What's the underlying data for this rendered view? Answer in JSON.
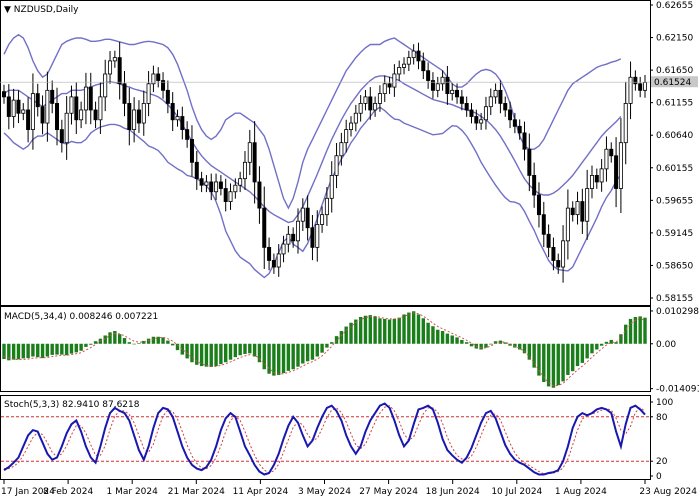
{
  "header": {
    "symbol": "NZDUSD,Daily",
    "macd_label": "MACD(5,34,4) 0.008246 0.007221",
    "stoch_label": "Stoch(5,3,3) 82.9410 87.6218"
  },
  "colors": {
    "candle": "#000000",
    "bands": "#7070c8",
    "macd_hist": "#1a7f1a",
    "macd_signal": "#d05050",
    "stoch_main": "#1818b0",
    "stoch_signal": "#d04040",
    "level_line": "#d03030",
    "price_tag_bg": "#c8c8c8",
    "grid_line": "#000000"
  },
  "chart_data": [
    {
      "type": "candlestick",
      "panel": "price",
      "title": "NZDUSD,Daily",
      "ylim": [
        0.5815,
        0.6275
      ],
      "y_ticks": [
        "0.62655",
        "0.62150",
        "0.61650",
        "0.61155",
        "0.60640",
        "0.60155",
        "0.59655",
        "0.59145",
        "0.58650",
        "0.58155"
      ],
      "last_price": "0.61524",
      "x_ticks": [
        "17 Jan 2024",
        "8 Feb 2024",
        "1 Mar 2024",
        "21 Mar 2024",
        "11 Apr 2024",
        "3 May 2024",
        "27 May 2024",
        "18 Jun 2024",
        "10 Jul 2024",
        "1 Aug 2024",
        "23 Aug 2024"
      ],
      "close": [
        0.613,
        0.61,
        0.6125,
        0.6105,
        0.611,
        0.608,
        0.6135,
        0.6115,
        0.609,
        0.614,
        0.612,
        0.608,
        0.606,
        0.6105,
        0.613,
        0.6095,
        0.611,
        0.6145,
        0.611,
        0.6095,
        0.613,
        0.6165,
        0.6185,
        0.619,
        0.615,
        0.612,
        0.608,
        0.611,
        0.609,
        0.612,
        0.615,
        0.6165,
        0.6155,
        0.614,
        0.612,
        0.6095,
        0.61,
        0.608,
        0.6065,
        0.603,
        0.6005,
        0.5995,
        0.6,
        0.5985,
        0.6,
        0.599,
        0.597,
        0.5985,
        0.5995,
        0.6005,
        0.603,
        0.606,
        0.6,
        0.596,
        0.59,
        0.588,
        0.587,
        0.589,
        0.5905,
        0.592,
        0.591,
        0.594,
        0.596,
        0.593,
        0.59,
        0.5935,
        0.595,
        0.5975,
        0.601,
        0.604,
        0.606,
        0.608,
        0.609,
        0.6105,
        0.612,
        0.613,
        0.611,
        0.612,
        0.6135,
        0.615,
        0.6145,
        0.6165,
        0.6175,
        0.618,
        0.619,
        0.62,
        0.6185,
        0.617,
        0.6155,
        0.614,
        0.615,
        0.616,
        0.6135,
        0.614,
        0.613,
        0.612,
        0.611,
        0.61,
        0.609,
        0.6095,
        0.6115,
        0.613,
        0.614,
        0.612,
        0.611,
        0.6095,
        0.6085,
        0.6075,
        0.605,
        0.601,
        0.598,
        0.595,
        0.592,
        0.59,
        0.588,
        0.587,
        0.591,
        0.596,
        0.595,
        0.597,
        0.594,
        0.599,
        0.601,
        0.6,
        0.602,
        0.605,
        0.604,
        0.599,
        0.606,
        0.612,
        0.616,
        0.615,
        0.614,
        0.6152
      ],
      "bands": {
        "upper": [
          0.6195,
          0.621,
          0.622,
          0.6225,
          0.622,
          0.6205,
          0.6185,
          0.617,
          0.616,
          0.6165,
          0.618,
          0.6195,
          0.621,
          0.6215,
          0.6218,
          0.622,
          0.622,
          0.6218,
          0.6215,
          0.6215,
          0.6216,
          0.6218,
          0.6218,
          0.6216,
          0.6214,
          0.6212,
          0.621,
          0.621,
          0.6212,
          0.6214,
          0.6215,
          0.6214,
          0.6212,
          0.621,
          0.6205,
          0.6195,
          0.618,
          0.616,
          0.614,
          0.6115,
          0.6095,
          0.608,
          0.607,
          0.6065,
          0.607,
          0.608,
          0.6095,
          0.61,
          0.6105,
          0.6105,
          0.61,
          0.6095,
          0.609,
          0.608,
          0.607,
          0.605,
          0.6025,
          0.6,
          0.5975,
          0.596,
          0.5975,
          0.6,
          0.603,
          0.605,
          0.6065,
          0.608,
          0.6095,
          0.611,
          0.6125,
          0.614,
          0.6155,
          0.617,
          0.618,
          0.619,
          0.6198,
          0.6205,
          0.621,
          0.621,
          0.621,
          0.6215,
          0.6218,
          0.622,
          0.6215,
          0.621,
          0.6205,
          0.62,
          0.6195,
          0.619,
          0.6185,
          0.618,
          0.6175,
          0.617,
          0.616,
          0.615,
          0.6145,
          0.6145,
          0.615,
          0.6158,
          0.6165,
          0.617,
          0.6172,
          0.617,
          0.6165,
          0.6155,
          0.614,
          0.612,
          0.6095,
          0.607,
          0.6055,
          0.605,
          0.605,
          0.6055,
          0.6065,
          0.608,
          0.6095,
          0.611,
          0.6125,
          0.614,
          0.615,
          0.6155,
          0.616,
          0.6165,
          0.617,
          0.6175,
          0.6178,
          0.618,
          0.6183,
          0.6185,
          0.6188
        ],
        "middle": [
          0.6135,
          0.614,
          0.614,
          0.614,
          0.6135,
          0.613,
          0.6125,
          0.612,
          0.6115,
          0.612,
          0.6125,
          0.613,
          0.6135,
          0.6135,
          0.614,
          0.614,
          0.614,
          0.6142,
          0.6145,
          0.6148,
          0.615,
          0.6152,
          0.6153,
          0.6152,
          0.615,
          0.6147,
          0.6145,
          0.6142,
          0.614,
          0.6138,
          0.6135,
          0.6133,
          0.613,
          0.6125,
          0.6118,
          0.611,
          0.61,
          0.6088,
          0.6075,
          0.6062,
          0.605,
          0.604,
          0.6032,
          0.6025,
          0.602,
          0.6015,
          0.601,
          0.6005,
          0.6,
          0.5995,
          0.599,
          0.5985,
          0.5978,
          0.597,
          0.5962,
          0.5955,
          0.595,
          0.5946,
          0.5942,
          0.5938,
          0.594,
          0.595,
          0.5962,
          0.5978,
          0.5995,
          0.6012,
          0.603,
          0.6048,
          0.6065,
          0.608,
          0.6095,
          0.6108,
          0.612,
          0.613,
          0.614,
          0.6148,
          0.6155,
          0.616,
          0.6162,
          0.6162,
          0.616,
          0.6158,
          0.6155,
          0.615,
          0.6146,
          0.6142,
          0.6138,
          0.6134,
          0.613,
          0.6126,
          0.6124,
          0.6122,
          0.612,
          0.6118,
          0.6115,
          0.6112,
          0.611,
          0.6108,
          0.6105,
          0.61,
          0.6095,
          0.6088,
          0.608,
          0.607,
          0.6058,
          0.6045,
          0.6032,
          0.6018,
          0.6005,
          0.5995,
          0.5988,
          0.5982,
          0.598,
          0.598,
          0.5983,
          0.5988,
          0.5995,
          0.6002,
          0.601,
          0.602,
          0.603,
          0.604,
          0.605,
          0.606,
          0.607,
          0.6078,
          0.6085,
          0.6092,
          0.61
        ],
        "lower": [
          0.6075,
          0.6068,
          0.606,
          0.6055,
          0.605,
          0.6055,
          0.6065,
          0.607,
          0.607,
          0.6075,
          0.607,
          0.6065,
          0.606,
          0.6058,
          0.6062,
          0.606,
          0.606,
          0.6065,
          0.6075,
          0.608,
          0.6084,
          0.6086,
          0.6088,
          0.6088,
          0.6086,
          0.6082,
          0.608,
          0.6074,
          0.6068,
          0.6062,
          0.6055,
          0.6052,
          0.6048,
          0.604,
          0.603,
          0.6025,
          0.602,
          0.6016,
          0.601,
          0.6008,
          0.6005,
          0.6,
          0.5994,
          0.5985,
          0.597,
          0.595,
          0.5925,
          0.591,
          0.5895,
          0.5885,
          0.588,
          0.5875,
          0.5866,
          0.586,
          0.5854,
          0.586,
          0.5875,
          0.5892,
          0.5909,
          0.5916,
          0.5905,
          0.59,
          0.5894,
          0.5906,
          0.5925,
          0.5944,
          0.5965,
          0.5986,
          0.6005,
          0.602,
          0.6035,
          0.6046,
          0.606,
          0.607,
          0.6082,
          0.6091,
          0.61,
          0.611,
          0.6114,
          0.6109,
          0.6102,
          0.6096,
          0.6095,
          0.609,
          0.6087,
          0.6084,
          0.6081,
          0.6078,
          0.6075,
          0.6072,
          0.6073,
          0.6074,
          0.608,
          0.6086,
          0.6085,
          0.6079,
          0.607,
          0.6058,
          0.6045,
          0.603,
          0.6018,
          0.6006,
          0.5995,
          0.5985,
          0.5976,
          0.597,
          0.5969,
          0.5966,
          0.5955,
          0.594,
          0.5926,
          0.5909,
          0.5895,
          0.588,
          0.5871,
          0.5866,
          0.5865,
          0.5864,
          0.587,
          0.5885,
          0.59,
          0.5915,
          0.593,
          0.5945,
          0.5962,
          0.5976,
          0.5987,
          0.6001,
          0.6012
        ]
      }
    },
    {
      "type": "bar",
      "panel": "macd",
      "title": "MACD(5,34,4) 0.008246 0.007221",
      "ylim": [
        -0.0142,
        0.0106
      ],
      "y_ticks": [
        "0.010298",
        "0.00",
        "-0.014091"
      ],
      "histogram": [
        -0.0048,
        -0.0052,
        -0.005,
        -0.0049,
        -0.0046,
        -0.0045,
        -0.004,
        -0.0042,
        -0.0045,
        -0.004,
        -0.0035,
        -0.0034,
        -0.0034,
        -0.0036,
        -0.0031,
        -0.0027,
        -0.0022,
        -0.001,
        -0.0003,
        0.0008,
        0.0016,
        0.0026,
        0.0036,
        0.004,
        0.003,
        0.0018,
        0.0005,
        0.0,
        0.0002,
        0.0009,
        0.0016,
        0.0022,
        0.0022,
        0.002,
        0.001,
        -0.0005,
        -0.002,
        -0.0034,
        -0.0046,
        -0.0058,
        -0.0066,
        -0.007,
        -0.0072,
        -0.0073,
        -0.007,
        -0.0064,
        -0.0058,
        -0.005,
        -0.0042,
        -0.0036,
        -0.0032,
        -0.003,
        -0.004,
        -0.0058,
        -0.008,
        -0.0094,
        -0.01,
        -0.0098,
        -0.0092,
        -0.0085,
        -0.008,
        -0.0072,
        -0.0062,
        -0.0055,
        -0.005,
        -0.004,
        -0.0028,
        -0.0012,
        0.0005,
        0.0024,
        0.004,
        0.0054,
        0.0066,
        0.0076,
        0.0084,
        0.0088,
        0.009,
        0.0086,
        0.008,
        0.0078,
        0.0076,
        0.0078,
        0.0082,
        0.0092,
        0.0098,
        0.0102,
        0.0092,
        0.008,
        0.0066,
        0.0055,
        0.0044,
        0.004,
        0.0032,
        0.0026,
        0.002,
        0.0012,
        0.0005,
        -0.0008,
        -0.0015,
        -0.0018,
        -0.0012,
        -0.0002,
        0.0008,
        0.001,
        0.0004,
        -0.0006,
        -0.0012,
        -0.0018,
        -0.003,
        -0.005,
        -0.0075,
        -0.01,
        -0.012,
        -0.0134,
        -0.0138,
        -0.013,
        -0.0118,
        -0.0098,
        -0.0086,
        -0.007,
        -0.006,
        -0.0046,
        -0.003,
        -0.0018,
        -0.0006,
        0.0006,
        0.0012,
        0.0005,
        0.003,
        0.006,
        0.0078,
        0.0084,
        0.0086,
        0.0082
      ],
      "signal": [
        -0.004,
        -0.0045,
        -0.0048,
        -0.005,
        -0.0049,
        -0.0048,
        -0.0045,
        -0.0044,
        -0.0044,
        -0.0043,
        -0.004,
        -0.0038,
        -0.0036,
        -0.0036,
        -0.0034,
        -0.0031,
        -0.0028,
        -0.002,
        -0.0012,
        -0.0002,
        0.0008,
        0.0017,
        0.0026,
        0.0032,
        0.0031,
        0.0025,
        0.0016,
        0.0008,
        0.0005,
        0.0006,
        0.001,
        0.0015,
        0.0019,
        0.002,
        0.0016,
        0.0008,
        -0.0004,
        -0.0017,
        -0.003,
        -0.0043,
        -0.0054,
        -0.0063,
        -0.0068,
        -0.0071,
        -0.0071,
        -0.0068,
        -0.0063,
        -0.0057,
        -0.005,
        -0.0043,
        -0.0038,
        -0.0034,
        -0.0036,
        -0.0046,
        -0.0062,
        -0.0078,
        -0.009,
        -0.0095,
        -0.0094,
        -0.009,
        -0.0085,
        -0.0078,
        -0.007,
        -0.0062,
        -0.0056,
        -0.0048,
        -0.0038,
        -0.0024,
        -0.0008,
        0.001,
        0.0026,
        0.0042,
        0.0055,
        0.0066,
        0.0076,
        0.0082,
        0.0086,
        0.0086,
        0.0083,
        0.008,
        0.0078,
        0.0078,
        0.008,
        0.0086,
        0.0092,
        0.0097,
        0.0094,
        0.0087,
        0.0076,
        0.0065,
        0.0054,
        0.0047,
        0.004,
        0.0033,
        0.0026,
        0.0019,
        0.0011,
        0.0002,
        -0.0007,
        -0.0013,
        -0.0013,
        -0.0007,
        0.0002,
        0.0006,
        0.0005,
        -0.0001,
        -0.0008,
        -0.0014,
        -0.0024,
        -0.004,
        -0.006,
        -0.0083,
        -0.0104,
        -0.0122,
        -0.0132,
        -0.0131,
        -0.0124,
        -0.011,
        -0.0096,
        -0.0082,
        -0.007,
        -0.0057,
        -0.0042,
        -0.0029,
        -0.0016,
        -0.0004,
        0.0005,
        0.0005,
        0.002,
        0.0042,
        0.0062,
        0.0074,
        0.008,
        0.0072
      ]
    },
    {
      "type": "line",
      "panel": "stochastic",
      "title": "Stoch(5,3,3) 82.9410 87.6218",
      "ylim": [
        0,
        100
      ],
      "y_ticks": [
        "100",
        "80",
        "20",
        "0"
      ],
      "levels": [
        80,
        20
      ],
      "series": [
        {
          "name": "main",
          "values": [
            8,
            12,
            18,
            25,
            40,
            55,
            62,
            60,
            45,
            30,
            22,
            25,
            40,
            58,
            70,
            75,
            60,
            40,
            25,
            18,
            40,
            65,
            85,
            92,
            88,
            85,
            75,
            55,
            35,
            22,
            40,
            65,
            85,
            92,
            90,
            80,
            60,
            40,
            25,
            15,
            10,
            8,
            12,
            22,
            40,
            62,
            78,
            85,
            80,
            60,
            40,
            28,
            15,
            6,
            2,
            4,
            15,
            30,
            50,
            68,
            80,
            72,
            55,
            40,
            48,
            65,
            80,
            92,
            95,
            88,
            75,
            55,
            40,
            30,
            40,
            60,
            75,
            85,
            95,
            98,
            92,
            75,
            55,
            40,
            48,
            70,
            90,
            92,
            95,
            90,
            72,
            50,
            35,
            28,
            22,
            18,
            25,
            38,
            55,
            72,
            85,
            88,
            78,
            60,
            42,
            30,
            22,
            18,
            15,
            10,
            5,
            2,
            2,
            4,
            5,
            8,
            20,
            40,
            65,
            80,
            85,
            82,
            85,
            90,
            92,
            90,
            85,
            60,
            40,
            70,
            92,
            95,
            90,
            83
          ]
        },
        {
          "name": "signal",
          "values": [
            10,
            10,
            13,
            18,
            28,
            40,
            52,
            59,
            56,
            45,
            32,
            26,
            30,
            41,
            56,
            68,
            68,
            58,
            42,
            28,
            28,
            41,
            63,
            81,
            88,
            88,
            83,
            72,
            55,
            37,
            32,
            43,
            63,
            81,
            89,
            87,
            77,
            60,
            42,
            27,
            17,
            11,
            10,
            14,
            25,
            41,
            60,
            75,
            81,
            75,
            60,
            43,
            28,
            16,
            8,
            4,
            7,
            16,
            32,
            49,
            66,
            73,
            69,
            56,
            48,
            51,
            64,
            79,
            89,
            92,
            86,
            73,
            57,
            42,
            37,
            43,
            58,
            73,
            85,
            93,
            95,
            88,
            74,
            57,
            48,
            53,
            69,
            84,
            92,
            92,
            86,
            71,
            52,
            38,
            28,
            23,
            22,
            27,
            39,
            55,
            71,
            82,
            84,
            76,
            60,
            44,
            31,
            23,
            18,
            14,
            10,
            6,
            3,
            3,
            4,
            6,
            11,
            23,
            42,
            62,
            77,
            82,
            84,
            86,
            89,
            91,
            89,
            78,
            62,
            57,
            67,
            86,
            92,
            88
          ]
        }
      ]
    }
  ]
}
